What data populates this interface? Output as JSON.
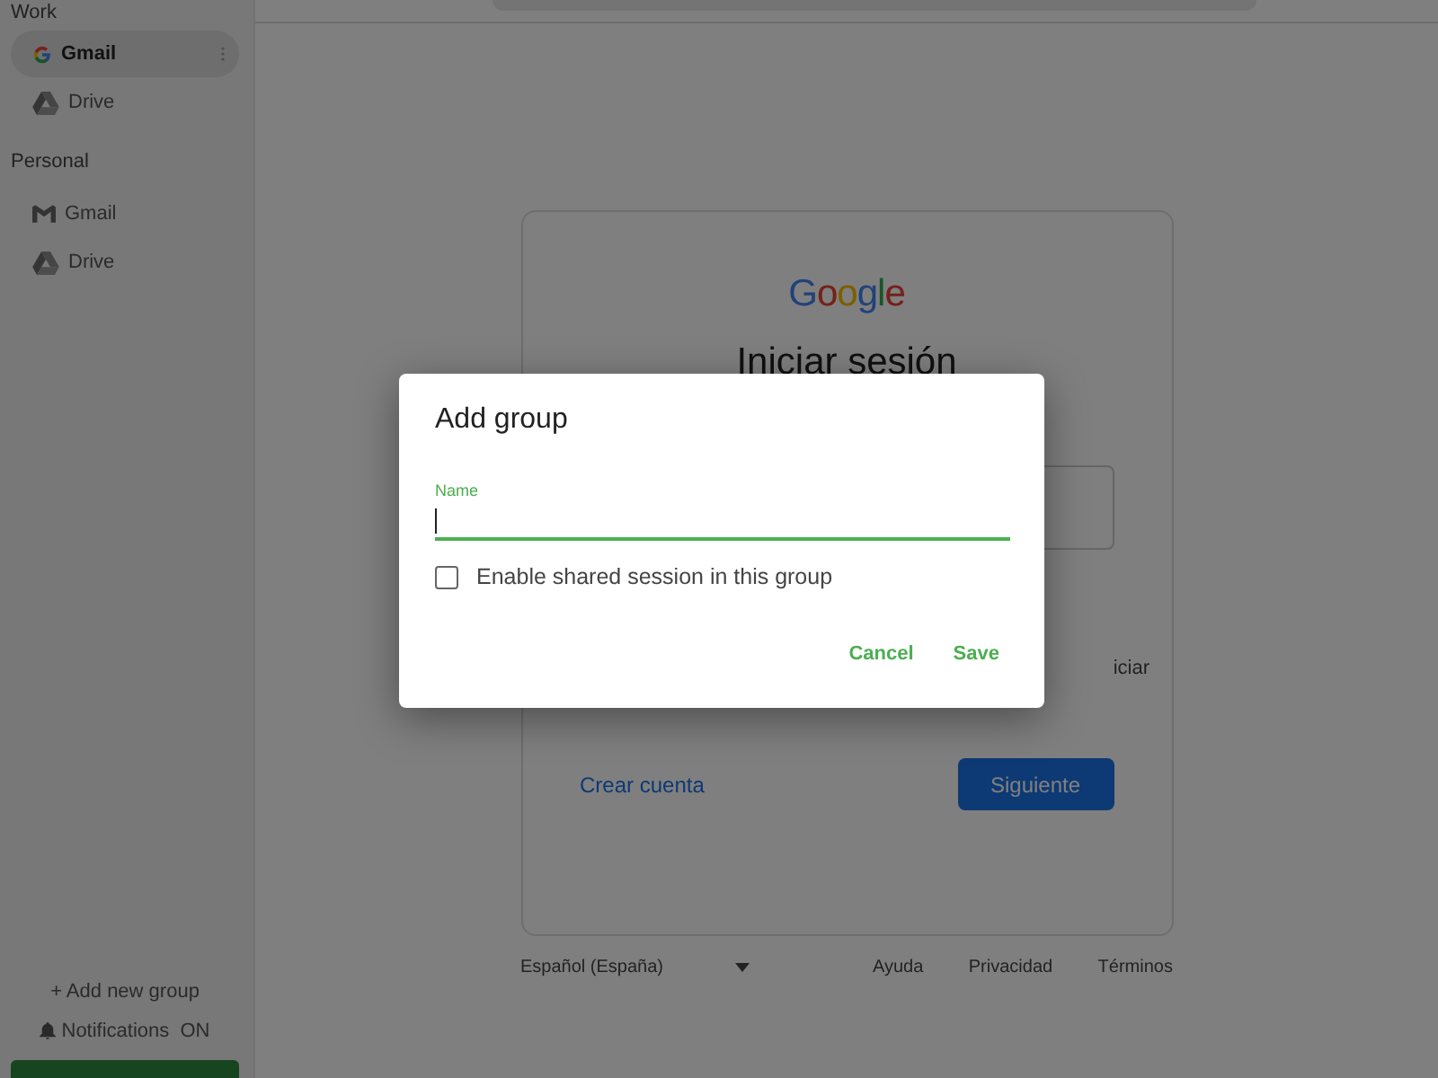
{
  "sidebar": {
    "groups": [
      {
        "title": "Work",
        "items": [
          {
            "label": "Gmail",
            "kind": "google",
            "selected": true
          },
          {
            "label": "Drive",
            "kind": "drive",
            "selected": false
          }
        ]
      },
      {
        "title": "Personal",
        "items": [
          {
            "label": "Gmail",
            "kind": "gmail",
            "selected": false
          },
          {
            "label": "Drive",
            "kind": "drive",
            "selected": false
          }
        ]
      }
    ],
    "add_group": "+ Add new group",
    "notifications": {
      "label": "Notifications",
      "state": "ON"
    }
  },
  "login": {
    "logo": "Google",
    "title": "Iniciar sesión",
    "note_fragment": "iciar",
    "create_account": "Crear cuenta",
    "next": "Siguiente"
  },
  "footer": {
    "language": "Español (España)",
    "links": [
      "Ayuda",
      "Privacidad",
      "Términos"
    ]
  },
  "dialog": {
    "title": "Add group",
    "field": {
      "label": "Name"
    },
    "checkbox": {
      "label": "Enable shared session in this group",
      "checked": false
    },
    "buttons": [
      "Cancel",
      "Save"
    ]
  }
}
